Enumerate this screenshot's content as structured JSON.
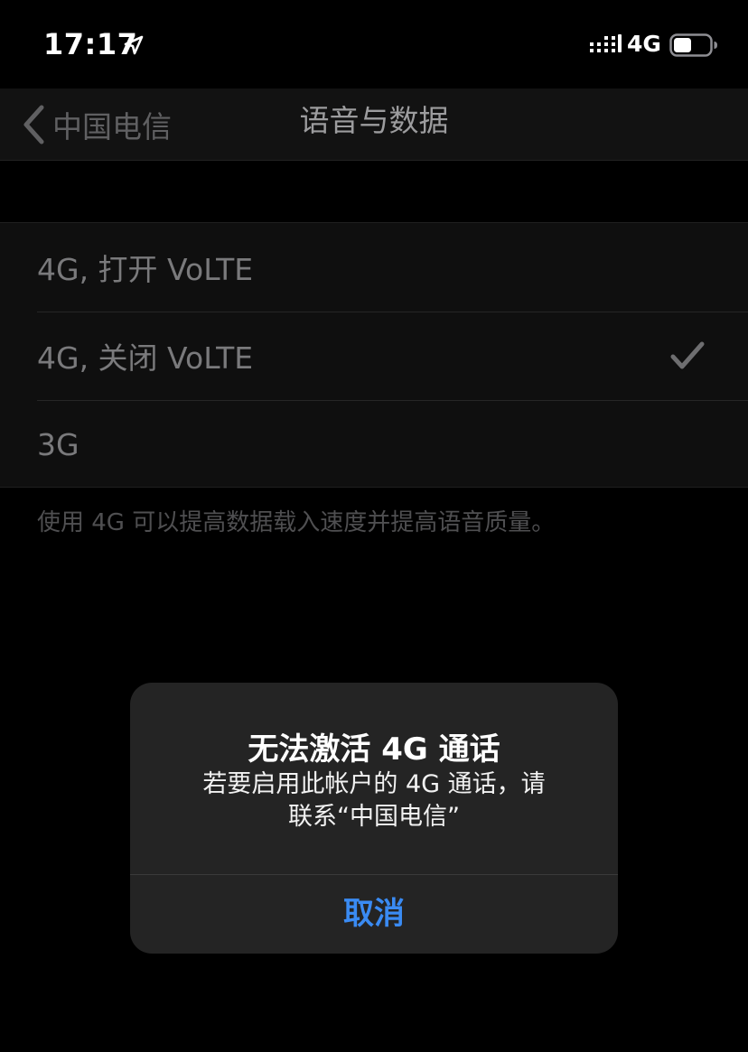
{
  "status_bar": {
    "time": "17:17",
    "network": "4G",
    "icons": [
      "location-arrow-icon",
      "signal-bars-icon",
      "battery-icon"
    ]
  },
  "nav": {
    "back_label": "中国电信",
    "title": "语音与数据"
  },
  "options": [
    {
      "label": "4G, 打开 VoLTE",
      "selected": false
    },
    {
      "label": "4G, 关闭 VoLTE",
      "selected": true
    },
    {
      "label": "3G",
      "selected": false
    }
  ],
  "footer_note": "使用 4G 可以提高数据载入速度并提高语音质量。",
  "alert": {
    "title": "无法激活 4G 通话",
    "message_line1": "若要启用此帐户的 4G 通话，请",
    "message_line2": "联系“中国电信”",
    "cancel_label": "取消"
  },
  "colors": {
    "background": "#000000",
    "alert_background": "#242424",
    "accent_blue": "#3a8bf3"
  }
}
